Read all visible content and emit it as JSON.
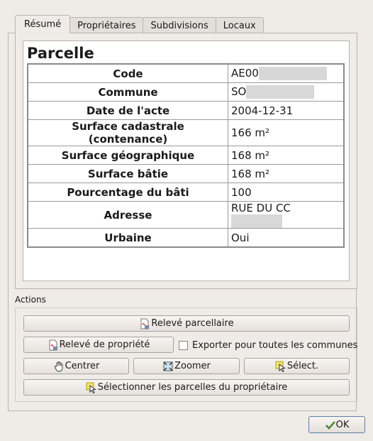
{
  "tabs": [
    "Résumé",
    "Propriétaires",
    "Subdivisions",
    "Locaux"
  ],
  "parcel": {
    "title": "Parcelle",
    "rows": [
      {
        "label": "Code",
        "value": "AE00",
        "redacted": true
      },
      {
        "label": "Commune",
        "value": "SO",
        "redacted": true
      },
      {
        "label": "Date de l'acte",
        "value": "2004-12-31"
      },
      {
        "label": "Surface cadastrale (contenance)",
        "value": "166 m²"
      },
      {
        "label": "Surface géographique",
        "value": "168 m²"
      },
      {
        "label": "Surface bâtie",
        "value": "168 m²"
      },
      {
        "label": "Pourcentage du bâti",
        "value": "100"
      },
      {
        "label": "Adresse",
        "value": "RUE DU CC",
        "redacted": true
      },
      {
        "label": "Urbaine",
        "value": "Oui"
      }
    ]
  },
  "actions": {
    "label": "Actions",
    "releve_parcellaire": "Relevé parcellaire",
    "releve_propriete": "Relevé de propriété",
    "exporter_toutes_communes": "Exporter pour toutes les communes",
    "centrer": "Centrer",
    "zoomer": "Zoomer",
    "select": "Sélect.",
    "selectionner_parcelles": "Sélectionner les parcelles du propriétaire"
  },
  "ok_label": "OK",
  "icons": {
    "pdf": "pdf-document-icon",
    "hand": "pan-hand-icon",
    "zoom": "zoom-extent-icon",
    "select": "select-arrow-icon",
    "ok": "ok-check-icon"
  }
}
